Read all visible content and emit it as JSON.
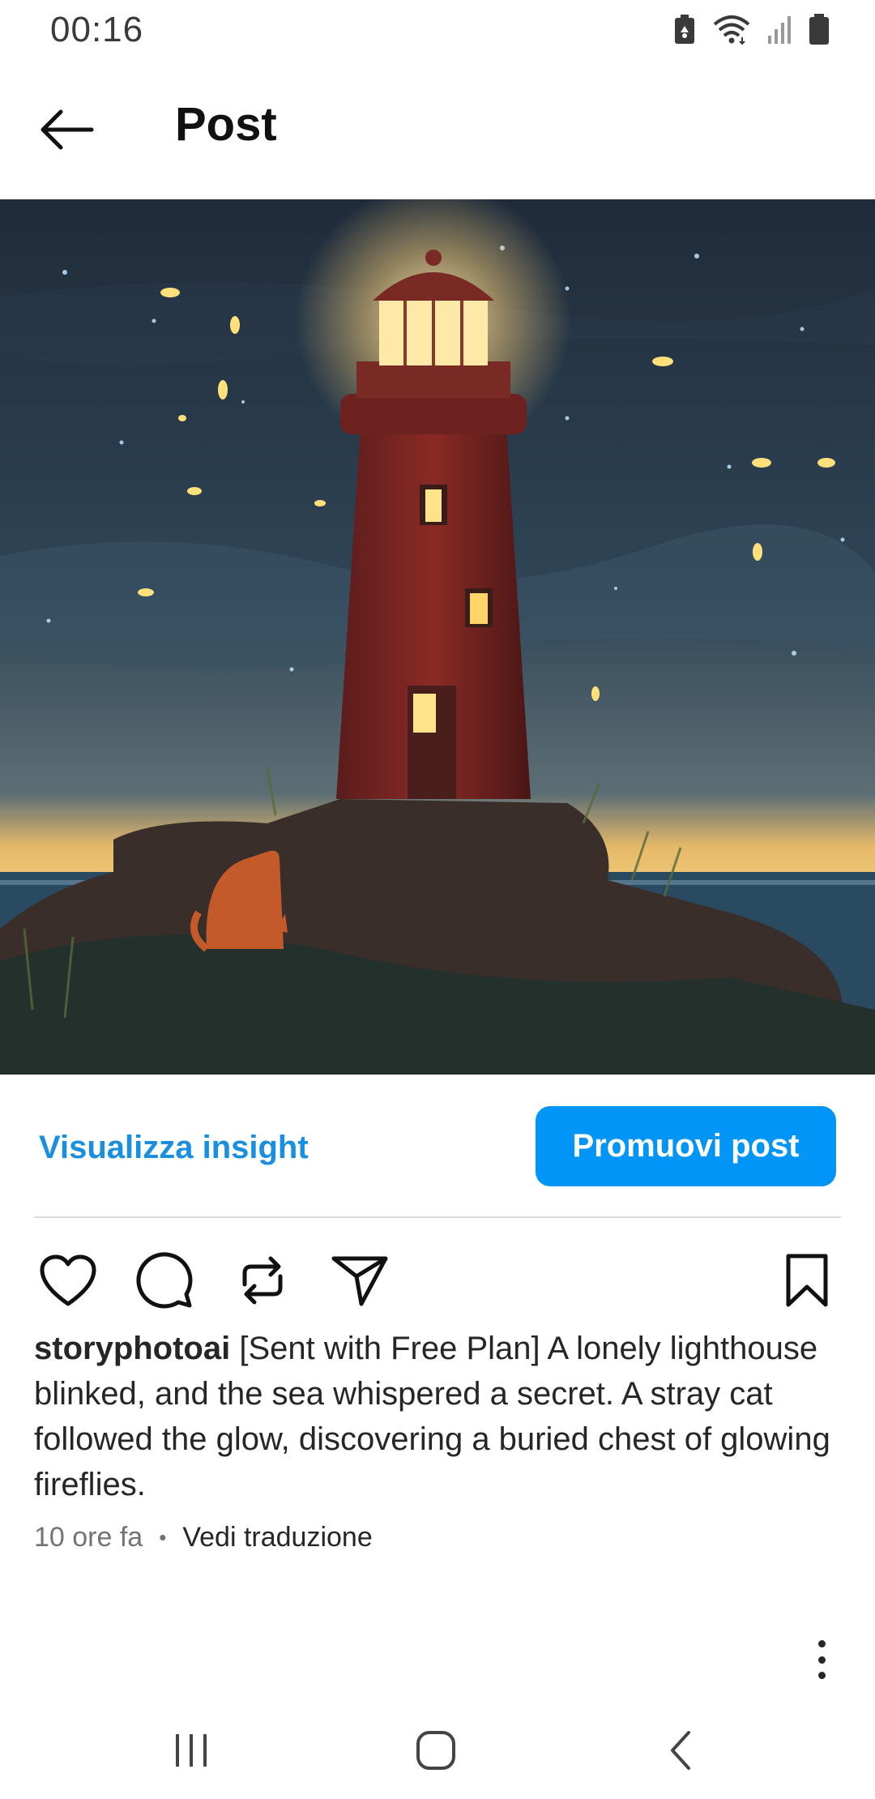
{
  "status_bar": {
    "time": "00:16",
    "icons": [
      "battery-saver-icon",
      "wifi-icon",
      "signal-icon",
      "battery-icon"
    ]
  },
  "header": {
    "title": "Post",
    "back_icon": "arrow-left-icon"
  },
  "post": {
    "image_icon": "post-image",
    "insight_label": "Visualizza insight",
    "promote_label": "Promuovi post",
    "actions": [
      "heart-icon",
      "comment-icon",
      "repost-icon",
      "share-icon",
      "bookmark-icon"
    ],
    "username": "storyphotoai",
    "caption": " [Sent with Free Plan] A lonely lighthouse blinked, and the sea whispered a secret. A stray cat followed the glow, discovering a buried chest of glowing fireflies.",
    "time_ago": "10 ore fa",
    "separator": "•",
    "translate_label": "Vedi traduzione"
  },
  "colors": {
    "accent": "#0095f6",
    "link": "#1a8fe0",
    "text": "#262626",
    "muted": "#737373"
  },
  "nav_bar": {
    "icons": [
      "recents-icon",
      "home-icon",
      "back-icon"
    ]
  }
}
